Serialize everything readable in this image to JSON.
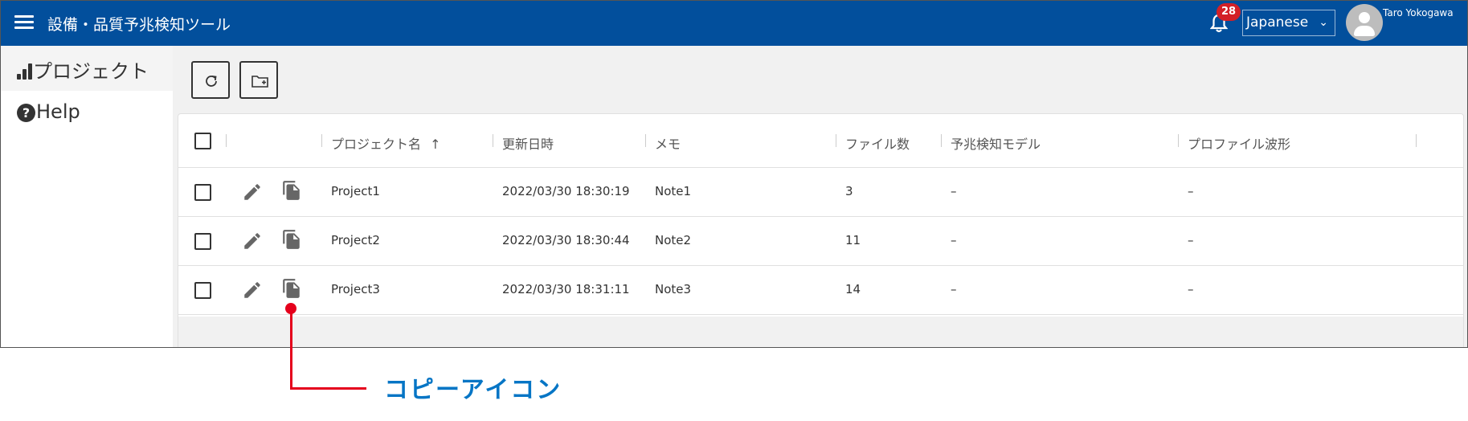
{
  "header": {
    "title": "設備・品質予兆検知ツール",
    "notification_count": "28",
    "language": "Japanese",
    "user_name": "Taro Yokogawa"
  },
  "sidebar": {
    "items": [
      {
        "label": "プロジェクト",
        "icon": "bar-chart-icon",
        "active": true
      },
      {
        "label": "Help",
        "icon": "help-circle-icon",
        "active": false
      }
    ]
  },
  "toolbar": {
    "buttons": [
      {
        "icon": "refresh-icon"
      },
      {
        "icon": "new-folder-icon"
      }
    ]
  },
  "table": {
    "columns": [
      "プロジェクト名",
      "更新日時",
      "メモ",
      "ファイル数",
      "予兆検知モデル",
      "プロファイル波形"
    ],
    "sort_column": "プロジェクト名",
    "sort_direction": "ascending",
    "rows": [
      {
        "name": "Project1",
        "updated": "2022/03/30 18:30:19",
        "memo": "Note1",
        "files": "3",
        "model": "–",
        "profile": "–"
      },
      {
        "name": "Project2",
        "updated": "2022/03/30 18:30:44",
        "memo": "Note2",
        "files": "11",
        "model": "–",
        "profile": "–"
      },
      {
        "name": "Project3",
        "updated": "2022/03/30 18:31:11",
        "memo": "Note3",
        "files": "14",
        "model": "–",
        "profile": "–"
      }
    ]
  },
  "annotation": {
    "label": "コピーアイコン",
    "color": "#e5001c",
    "text_color": "#0575c5"
  },
  "colors": {
    "header_bg": "#024f9c",
    "badge_bg": "#d32027"
  }
}
